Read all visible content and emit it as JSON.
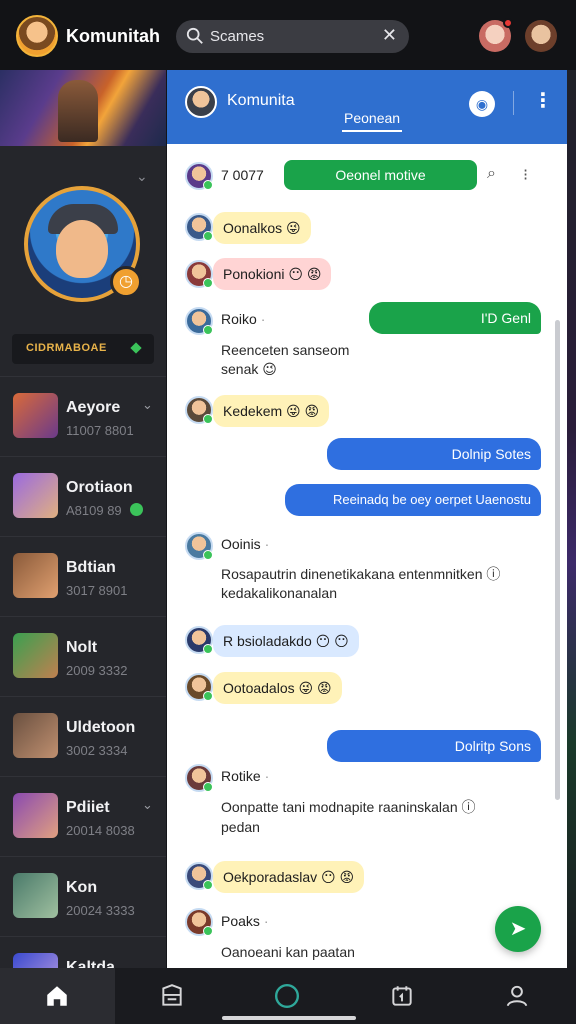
{
  "topbar": {
    "title": "Komunitah",
    "search_text": "Scames",
    "clear_icon": "close-icon"
  },
  "sidebar": {
    "tag_text": "CIDRMABOAE",
    "items": [
      {
        "name": "Aeyore",
        "sub": "11007 8801",
        "avatar_color": "#b56a4c"
      },
      {
        "name": "Orotiaon",
        "sub": "A8109 89",
        "avatar_color": "#7b5bd0"
      },
      {
        "name": "Bdtian",
        "sub": "3017 8901",
        "avatar_color": "#6b4a38"
      },
      {
        "name": "Nolt",
        "sub": "2009 3332",
        "avatar_color": "#8a5a3a"
      },
      {
        "name": "Uldetoon",
        "sub": "3002 3334",
        "avatar_color": "#5a4a3a"
      },
      {
        "name": "Pdiiet",
        "sub": "20014 8038",
        "avatar_color": "#7a4aa0"
      },
      {
        "name": "Kon",
        "sub": "20024 3333",
        "avatar_color": "#4a6a5a"
      },
      {
        "name": "Kaltda",
        "sub": "",
        "avatar_color": "#4a5ad0"
      }
    ]
  },
  "chat": {
    "header": {
      "title": "Komunita",
      "tab": "Peonean"
    },
    "first_row": {
      "label": "7 0077",
      "button": "Oeonel motive"
    },
    "messages": [
      {
        "type": "bubble",
        "text": "Oonalkos 😜"
      },
      {
        "type": "bubble",
        "text": "Ponokioni 😶 😡"
      },
      {
        "type": "out_green",
        "text": "I'D Genl"
      },
      {
        "type": "text",
        "user": "Roiko",
        "body1": "Reenceten sanseom",
        "body2": "senak 😉"
      },
      {
        "type": "bubble",
        "text": "Kedekem 😜 😡"
      },
      {
        "type": "out_blue",
        "text": "Dolnip Sotes"
      },
      {
        "type": "out_blue",
        "text": "Reeinadq be oey oerpet Uaenostu"
      },
      {
        "type": "text",
        "user": "Ooinis",
        "body1": "Rosapautrin dinenetikakana entenmnitken ⓘ",
        "body2": "kedakalikonanalan"
      },
      {
        "type": "bubble",
        "text": "R bsioladakdo 😶 😶"
      },
      {
        "type": "bubble",
        "text": "Ootoadalos 😜 😡"
      },
      {
        "type": "out_blue",
        "text": "Dolritp Sons"
      },
      {
        "type": "text",
        "user": "Rotike",
        "body1": "Oonpatte tani modnapite raaninskalan ⓘ",
        "body2": "pedan"
      },
      {
        "type": "bubble",
        "text": "Oekporadaslav 😶 😡"
      },
      {
        "type": "text",
        "user": "Poaks",
        "body1": "Oanoeani kan paatan",
        "body2": ""
      }
    ]
  },
  "colors": {
    "accent": "#2f6fcf",
    "green": "#1aa34a",
    "sidebar": "#25262b"
  }
}
